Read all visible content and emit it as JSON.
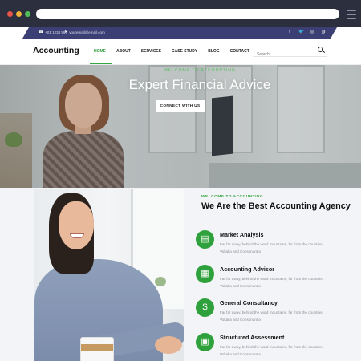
{
  "topbar": {
    "phone": "+01 1234 567",
    "email": "youremail@email.com",
    "socials": [
      "f",
      "t",
      "ig",
      "dr"
    ]
  },
  "nav": {
    "logo": "Accounting",
    "items": [
      "HOME",
      "ABOUT",
      "SERVICES",
      "CASE STUDY",
      "BLOG",
      "CONTACT"
    ],
    "active": "HOME",
    "search_placeholder": "Search"
  },
  "hero": {
    "tagline": "WELCOME TO ACCOUNTING",
    "title": "Expert Financial Advice",
    "button": "CONNECT WITH US"
  },
  "about": {
    "eyebrow": "WELCOME TO ACCOUNTING",
    "title": "We Are the Best Accounting Agency",
    "features": [
      {
        "title": "Market Analysis",
        "desc": "Far far away, behind the word mountains, far from the countries Vokalia and Consonantia",
        "icon": "chart-icon"
      },
      {
        "title": "Accounting Advisor",
        "desc": "Far far away, behind the word mountains, far from the countries Vokalia and Consonantia",
        "icon": "calculator-icon"
      },
      {
        "title": "General Consultancy",
        "desc": "Far far away, behind the word mountains, far from the countries Vokalia and Consonantia",
        "icon": "money-icon"
      },
      {
        "title": "Structured Assessment",
        "desc": "Far far away, behind the word mountains, far from the countries Vokalia and Consonantia",
        "icon": "document-icon"
      }
    ]
  },
  "colors": {
    "accent": "#2fa13c",
    "topbar": "#3c3f73",
    "chrome": "#2b2f3e"
  }
}
